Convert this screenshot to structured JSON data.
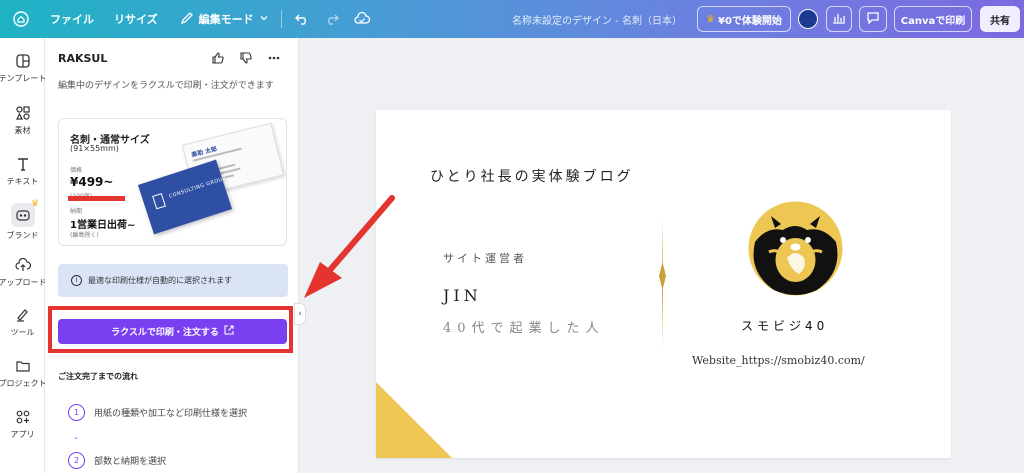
{
  "topbar": {
    "file": "ファイル",
    "resize": "リサイズ",
    "edit_mode": "編集モード",
    "doc_title": "名称未設定のデザイン - 名刺（日本）",
    "trial": "¥0で体験開始",
    "print": "Canvaで印刷",
    "share": "共有",
    "gradient_colors": [
      "#1fb3c4",
      "#6d7fe0",
      "#7b6ae0"
    ]
  },
  "rail": {
    "items": [
      {
        "label": "テンプレート",
        "icon": "template-icon"
      },
      {
        "label": "素材",
        "icon": "elements-icon"
      },
      {
        "label": "テキスト",
        "icon": "text-icon"
      },
      {
        "label": "ブランド",
        "icon": "brand-icon"
      },
      {
        "label": "アップロード",
        "icon": "upload-icon"
      },
      {
        "label": "ツール",
        "icon": "draw-icon"
      },
      {
        "label": "プロジェクト",
        "icon": "folder-icon"
      },
      {
        "label": "アプリ",
        "icon": "apps-icon"
      }
    ]
  },
  "panel": {
    "app_name": "RAKSUL",
    "description": "編集中のデザインをラクスルで印刷・注文ができます",
    "card": {
      "title": "名刺・通常サイズ",
      "size": "(91×55mm)",
      "price_label": "価格",
      "price": "¥499~",
      "qty": "(100部)",
      "delivery_label": "納期",
      "delivery": "1営業日出荷~",
      "delivery_note": "(離島除く)",
      "sample_name": "楽助 太郎",
      "sample_back": "CONSULTING GROUP"
    },
    "info": "最適な印刷仕様が自動的に選択されます",
    "order_button": "ラクスルで印刷・注文する",
    "flow_heading": "ご注文完了までの流れ",
    "steps": [
      {
        "num": "1",
        "text": "用紙の種類や加工など印刷仕様を選択"
      },
      {
        "num": "2",
        "text": "部数と納期を選択"
      }
    ],
    "accent": "#7b3ff2",
    "highlight": "#e3342f"
  },
  "design": {
    "blog": "ひとり社長の実体験ブログ",
    "owner_label": "サイト運営者",
    "name": "JIN",
    "tagline": "40代で起業した人",
    "site_name": "スモビジ40",
    "url": "Website_https://smobiz40.com/",
    "gold": "#c9a23a",
    "yellow": "#edc654"
  }
}
